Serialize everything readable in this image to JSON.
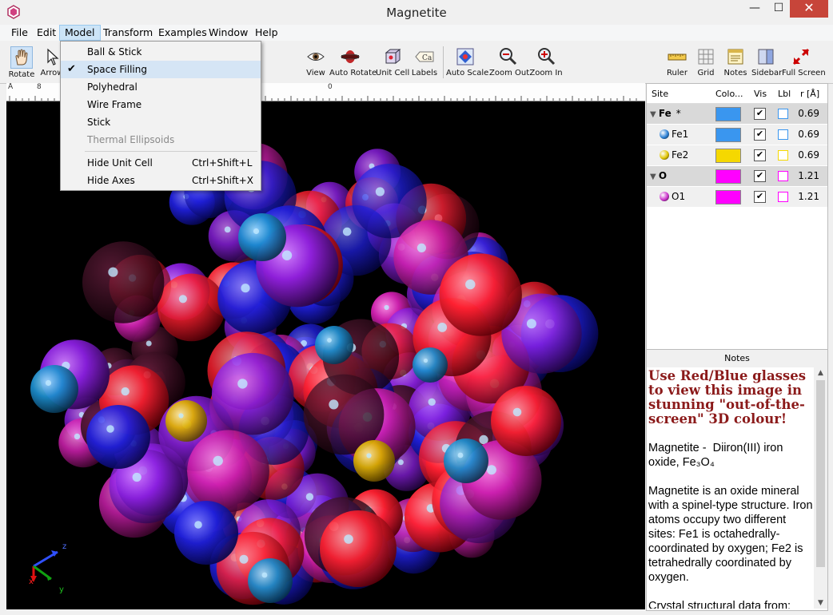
{
  "window": {
    "title": "Magnetite"
  },
  "menubar": [
    "File",
    "Edit",
    "Model",
    "Transform",
    "Examples",
    "Window",
    "Help"
  ],
  "toolbar": {
    "rotate": "Rotate",
    "arrow": "Arrow",
    "view": "View",
    "auto_rotate": "Auto Rotate",
    "unit_cell": "Unit Cell",
    "labels": "Labels",
    "auto_scale": "Auto Scale",
    "zoom_out": "Zoom Out",
    "zoom_in": "Zoom In",
    "ruler": "Ruler",
    "grid": "Grid",
    "notes": "Notes",
    "sidebar": "Sidebar",
    "full_screen": "Full Screen"
  },
  "ruler": {
    "unit": "Å",
    "marks": [
      "8",
      "0"
    ]
  },
  "model_menu": {
    "items": [
      {
        "label": "Ball & Stick",
        "shortcut": "",
        "checked": false,
        "disabled": false
      },
      {
        "label": "Space Filling",
        "shortcut": "",
        "checked": true,
        "disabled": false
      },
      {
        "label": "Polyhedral",
        "shortcut": "",
        "checked": false,
        "disabled": false
      },
      {
        "label": "Wire Frame",
        "shortcut": "",
        "checked": false,
        "disabled": false
      },
      {
        "label": "Stick",
        "shortcut": "",
        "checked": false,
        "disabled": false
      },
      {
        "label": "Thermal Ellipsoids",
        "shortcut": "",
        "checked": false,
        "disabled": true
      }
    ],
    "items2": [
      {
        "label": "Hide Unit Cell",
        "shortcut": "Ctrl+Shift+L"
      },
      {
        "label": "Hide Axes",
        "shortcut": "Ctrl+Shift+X"
      }
    ]
  },
  "sites_table": {
    "headers": {
      "site": "Site",
      "colour": "Colo...",
      "vis": "Vis",
      "lbl": "Lbl",
      "r": "r [Å]"
    },
    "rows": [
      {
        "site": "Fe",
        "suffix": "*",
        "group": true,
        "color": "#3a96ef",
        "ball": "",
        "vis": "✔",
        "r": "0.69"
      },
      {
        "site": "Fe1",
        "suffix": "",
        "group": false,
        "color": "#3a96ef",
        "ball": "#2a7fd4",
        "vis": "✔",
        "r": "0.69"
      },
      {
        "site": "Fe2",
        "suffix": "",
        "group": false,
        "color": "#f5d800",
        "ball": "#e0c400",
        "vis": "✔",
        "r": "0.69"
      },
      {
        "site": "O",
        "suffix": "",
        "group": true,
        "color": "#ff00ff",
        "ball": "",
        "vis": "✔",
        "r": "1.21"
      },
      {
        "site": "O1",
        "suffix": "",
        "group": false,
        "color": "#ff00ff",
        "ball": "#cc33cc",
        "vis": "✔",
        "r": "1.21"
      }
    ]
  },
  "notes": {
    "header": "Notes",
    "heading": "Use Red/Blue glasses to view this image in stunning \"out-of-the-screen\" 3D colour!",
    "para1": "Magnetite -⁬ ⁬ Diiron(III) iron oxide, Fe₃O₄",
    "para2": "Magnetite is an oxide mineral with a spinel-type structure. Iron atoms occupy two different sites: Fe1 is octahedrally-coordinated by oxygen; Fe2 is tetrahedrally coordinated by oxygen.",
    "para3": "Crystal structural data from:"
  },
  "axes": {
    "x": "x",
    "y": "y",
    "z": "z"
  }
}
